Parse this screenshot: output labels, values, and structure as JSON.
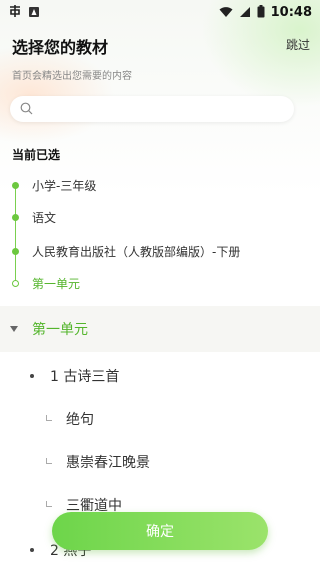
{
  "status_bar": {
    "time": "10:48"
  },
  "header": {
    "title": "选择您的教材",
    "subtitle": "首页会精选出您需要的内容",
    "skip_label": "跳过"
  },
  "search": {
    "placeholder": ""
  },
  "selected": {
    "title": "当前已选",
    "items": [
      {
        "label": "小学-三年级"
      },
      {
        "label": "语文"
      },
      {
        "label": "人民教育出版社（人教版部编版）-下册"
      },
      {
        "label": "第一单元"
      }
    ]
  },
  "unit": {
    "title": "第一单元",
    "lessons": [
      {
        "label": "1 古诗三首",
        "subs": [
          "绝句",
          "惠崇春江晚景",
          "三衢道中"
        ]
      },
      {
        "label": "2 燕子"
      }
    ]
  },
  "confirm_label": "确定",
  "colors": {
    "accent": "#54b52c",
    "button_start": "#6dd54a",
    "button_end": "#9be36b"
  }
}
